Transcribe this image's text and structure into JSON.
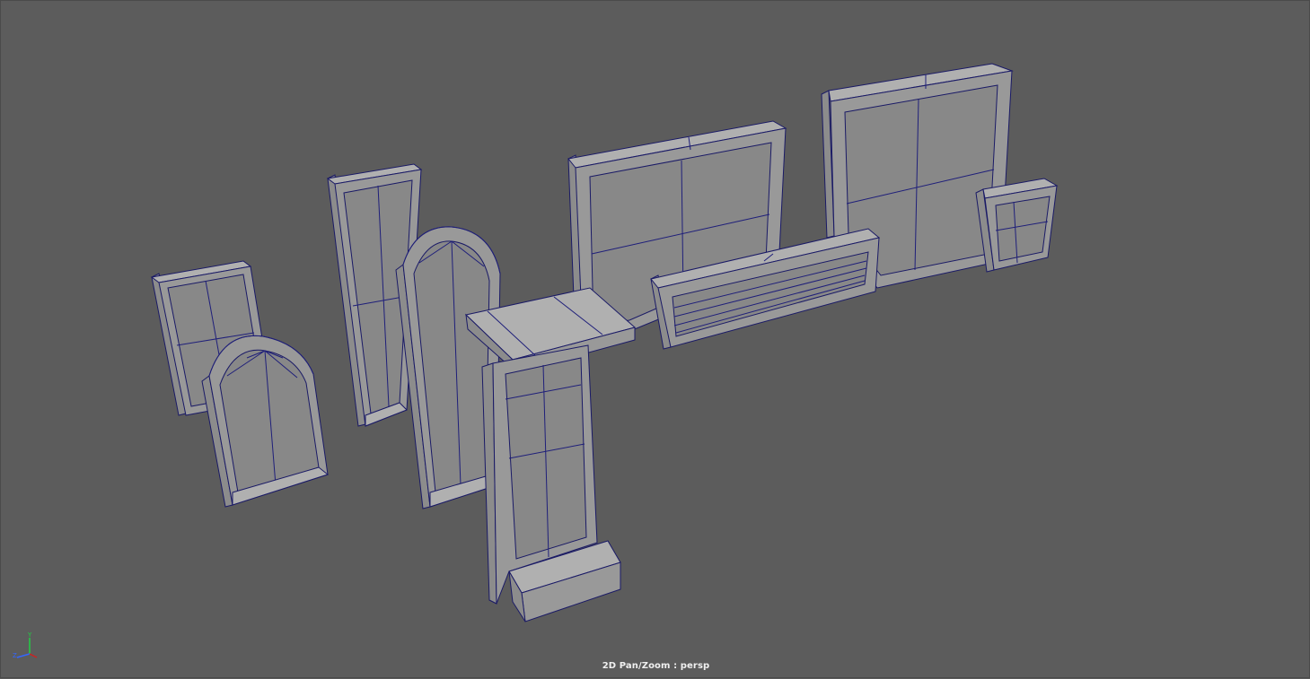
{
  "viewport": {
    "camera_label": "2D Pan/Zoom : persp",
    "background_color": "#5c5c5c",
    "wire_color": "#1a1a66"
  },
  "axis_gizmo": {
    "y_label": "Y",
    "z_label": "Z",
    "x_color": "#cc2222",
    "y_color": "#22cc44",
    "z_color": "#3366ff"
  },
  "objects": [
    {
      "name": "window-frame-small-left"
    },
    {
      "name": "window-arched-small"
    },
    {
      "name": "window-tall-narrow"
    },
    {
      "name": "window-arched-tall"
    },
    {
      "name": "window-frame-wide-center"
    },
    {
      "name": "window-sill-ledge"
    },
    {
      "name": "window-frame-large-right"
    },
    {
      "name": "shutter-louvered-panel"
    },
    {
      "name": "window-frame-small-square"
    },
    {
      "name": "window-tall-with-base"
    }
  ]
}
